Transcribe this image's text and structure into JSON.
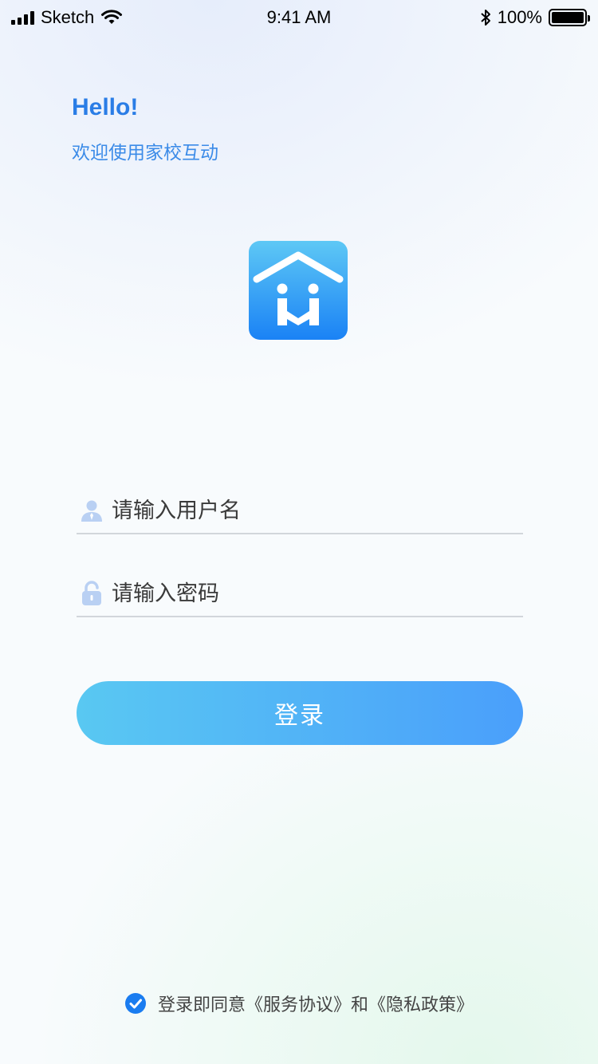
{
  "status_bar": {
    "carrier": "Sketch",
    "time": "9:41 AM",
    "battery": "100%"
  },
  "greeting": {
    "title": "Hello!",
    "subtitle": "欢迎使用家校互动"
  },
  "logo": {
    "icon": "home-handshake-icon",
    "colors": [
      "#5ec8f5",
      "#1a82f5"
    ]
  },
  "form": {
    "username_placeholder": "请输入用户名",
    "password_placeholder": "请输入密码",
    "login_label": "登录"
  },
  "agreement": {
    "checked": true,
    "text": "登录即同意《服务协议》和《隐私政策》"
  },
  "colors": {
    "accent": "#2a7de6",
    "button_start": "#59c8f2",
    "button_end": "#4a9ffb",
    "checkbox": "#1a7cf0"
  }
}
